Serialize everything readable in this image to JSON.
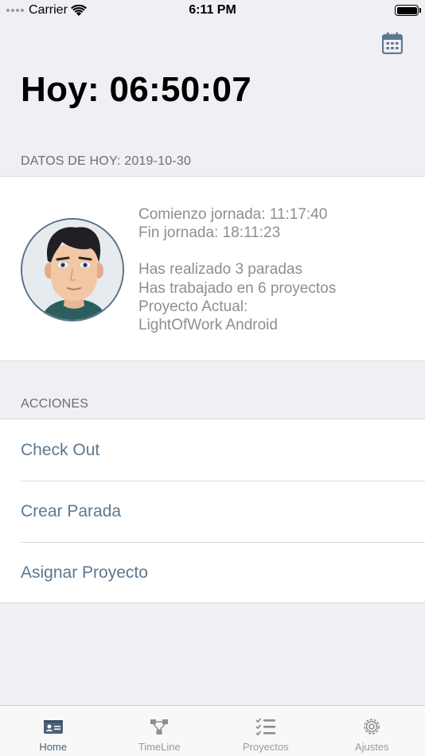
{
  "status_bar": {
    "carrier": "Carrier",
    "time": "6:11 PM"
  },
  "header": {
    "title": "Hoy: 06:50:07"
  },
  "today": {
    "section_label": "DATOS DE HOY: 2019-10-30",
    "start": "Comienzo jornada: 11:17:40",
    "end": "Fin jornada: 18:11:23",
    "stops": "Has realizado 3 paradas",
    "projects": "Has trabajado en 6 proyectos",
    "current_project_label": "Proyecto Actual:",
    "current_project": "LightOfWork Android"
  },
  "actions": {
    "section_label": "ACCIONES",
    "items": [
      "Check Out",
      "Crear Parada",
      "Asignar Proyecto"
    ]
  },
  "tabbar": {
    "tabs": [
      {
        "label": "Home",
        "icon": "id-card-icon",
        "active": true
      },
      {
        "label": "TimeLine",
        "icon": "timeline-icon",
        "active": false
      },
      {
        "label": "Proyectos",
        "icon": "checklist-icon",
        "active": false
      },
      {
        "label": "Ajustes",
        "icon": "gear-icon",
        "active": false
      }
    ]
  },
  "colors": {
    "accent": "#5c7891",
    "tab_active": "#4a6178",
    "tab_inactive": "#9a9a9e",
    "background": "#efeff4"
  }
}
